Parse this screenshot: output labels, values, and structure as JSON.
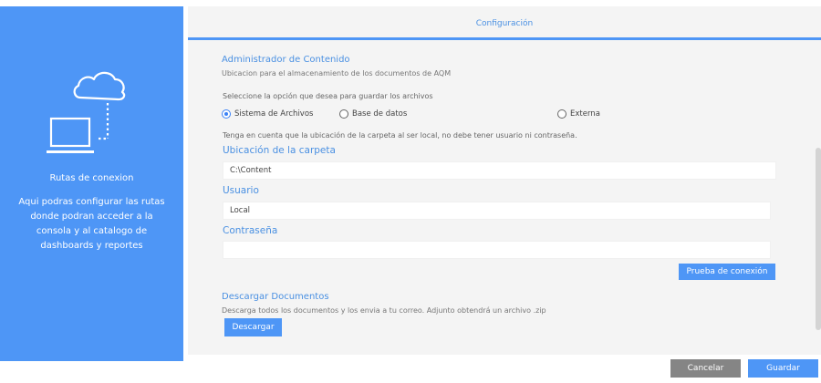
{
  "sidebar": {
    "illustration": "cloud-laptop-icon",
    "title": "Rutas de conexion",
    "description": "Aqui podras configurar las rutas donde podran acceder a la consola y al catalogo de dashboards y reportes"
  },
  "header": {
    "title": "Configuración"
  },
  "content_manager": {
    "title": "Administrador de Contenido",
    "subtitle": "Ubicacion para el almacenamiento de los documentos de AQM",
    "select_prompt": "Seleccione la opción que desea para guardar los archivos",
    "options": [
      {
        "label": "Sistema de Archivos",
        "selected": true
      },
      {
        "label": "Base de datos",
        "selected": false
      },
      {
        "label": "Externa",
        "selected": false
      }
    ],
    "note": "Tenga en cuenta que la ubicación de la carpeta al ser local, no debe tener usuario ni contraseña.",
    "folder_label": "Ubicación de la carpeta",
    "folder_value": "C:\\Content",
    "user_label": "Usuario",
    "user_value": "Local",
    "password_label": "Contraseña",
    "password_value": "",
    "test_button": "Prueba de conexión"
  },
  "download": {
    "title": "Descargar Documentos",
    "subtitle": "Descarga todos los documentos y los envia a tu correo. Adjunto obtendrá un archivo .zip",
    "button": "Descargar"
  },
  "footer": {
    "cancel": "Cancelar",
    "save": "Guardar"
  },
  "colors": {
    "accent": "#4e96f6",
    "link_text": "#4a90e2",
    "cancel": "#858585"
  }
}
